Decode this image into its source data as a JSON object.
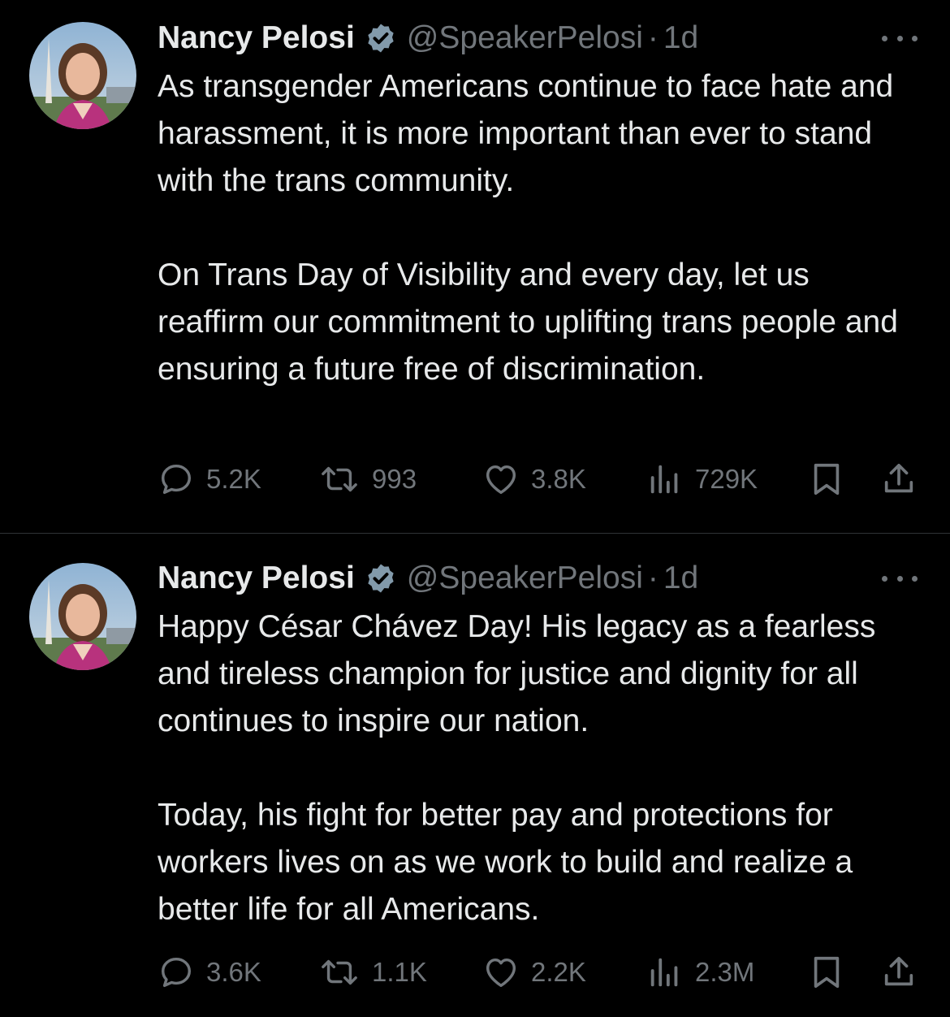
{
  "colors": {
    "background": "#000000",
    "text_primary": "#e7e9ea",
    "text_secondary": "#71767b",
    "divider": "#2f3336",
    "verified_badge": "#829aab"
  },
  "tweets": [
    {
      "author_name": "Nancy Pelosi",
      "handle": "@SpeakerPelosi",
      "separator": "·",
      "time": "1d",
      "paragraphs": [
        "As transgender Americans continue to face hate and harassment, it is more important than ever to stand with the trans community.",
        "On Trans Day of Visibility and every day, let us reaffirm our commitment to uplifting trans people and ensuring a future free of discrimination."
      ],
      "counts": {
        "replies": "5.2K",
        "reposts": "993",
        "likes": "3.8K",
        "views": "729K"
      }
    },
    {
      "author_name": "Nancy Pelosi",
      "handle": "@SpeakerPelosi",
      "separator": "·",
      "time": "1d",
      "paragraphs": [
        "Happy César Chávez Day! His legacy as a fearless and tireless champion for justice and dignity for all continues to inspire our nation.",
        "Today, his fight for better pay and protections for workers lives on as we work to build and realize a better life for all Americans."
      ],
      "counts": {
        "replies": "3.6K",
        "reposts": "1.1K",
        "likes": "2.2K",
        "views": "2.3M"
      }
    }
  ],
  "icons": {
    "reply": "comment-bubble-icon",
    "repost": "retweet-arrows-icon",
    "like": "heart-icon",
    "views": "bar-chart-icon",
    "bookmark": "bookmark-icon",
    "share": "share-upload-icon",
    "more": "more-horizontal-icon",
    "verified": "verified-badge-icon"
  }
}
